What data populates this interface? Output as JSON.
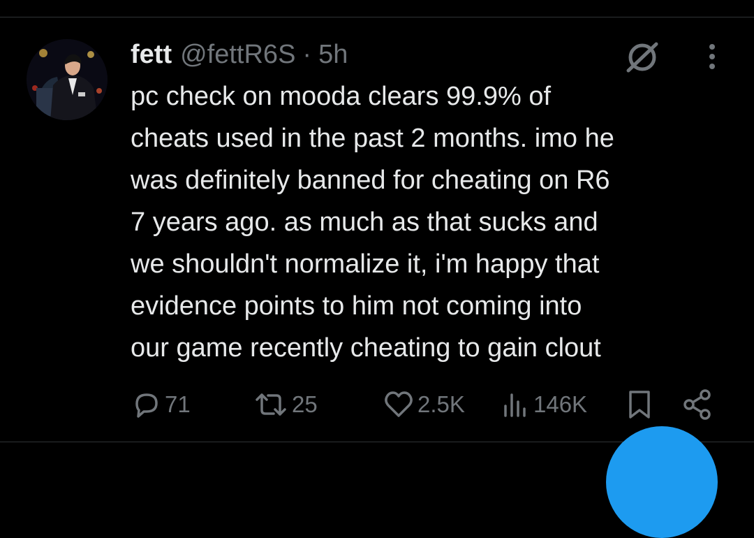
{
  "tweet": {
    "author": {
      "display_name": "fett",
      "handle": "@fettR6S",
      "separator": "·",
      "time": "5h",
      "avatar_icon": "profile-photo"
    },
    "text": "pc check on mooda clears 99.9% of\ncheats used in the past 2 months. imo he\nwas definitely banned for cheating on R6\n7 years ago. as much as that sucks and\nwe shouldn't normalize it, i'm happy that\nevidence points to him not coming into\nour game recently cheating to gain clout",
    "header_icons": [
      "grok-icon",
      "more-icon"
    ],
    "actions": {
      "replies": {
        "icon": "reply-icon",
        "count": "71"
      },
      "reposts": {
        "icon": "repost-icon",
        "count": "25"
      },
      "likes": {
        "icon": "like-icon",
        "count": "2.5K"
      },
      "views": {
        "icon": "views-icon",
        "count": "146K"
      },
      "bookmark": {
        "icon": "bookmark-icon"
      },
      "share": {
        "icon": "share-icon"
      }
    }
  },
  "theme": {
    "background": "#000000",
    "text": "#e7e9ea",
    "muted": "#71767b",
    "divider": "#2f3336",
    "accent": "#1d9bf0"
  }
}
